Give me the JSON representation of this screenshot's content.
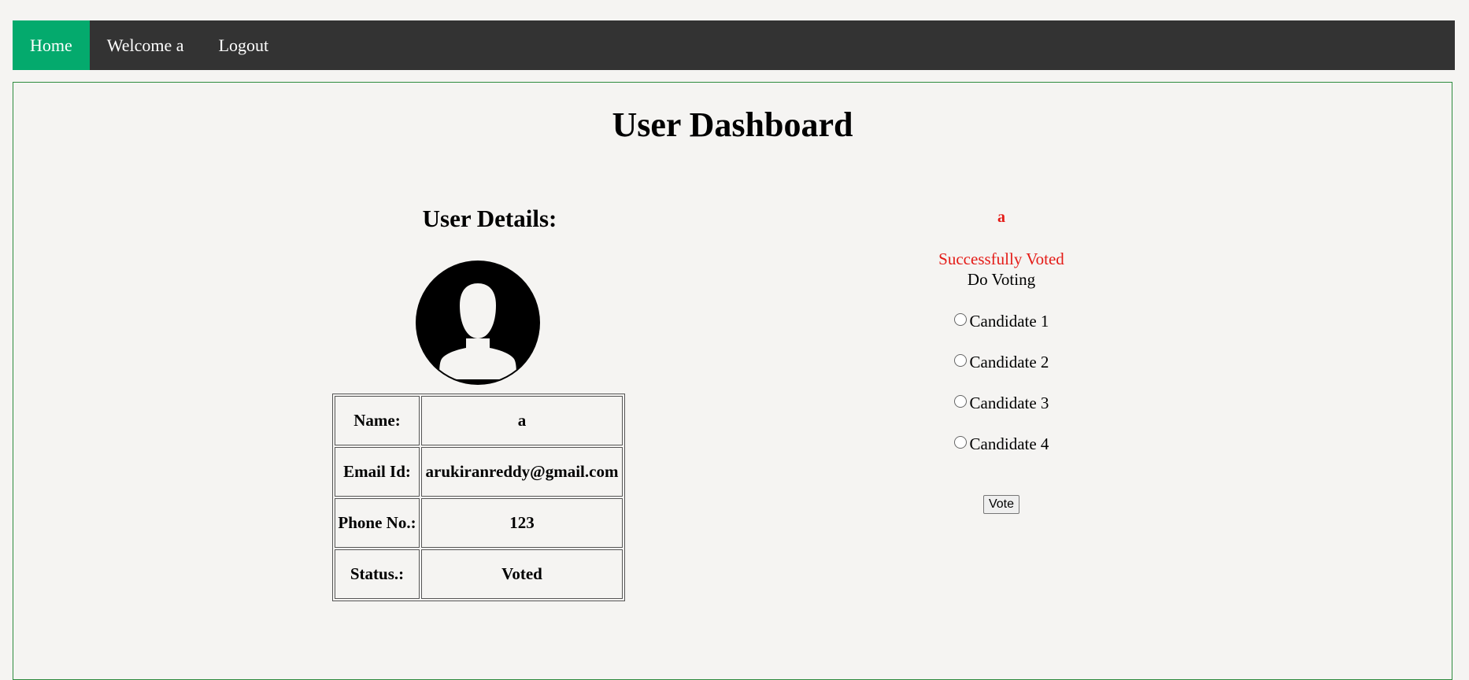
{
  "nav": {
    "items": [
      {
        "label": "Home",
        "active": true
      },
      {
        "label": "Welcome a",
        "active": false
      },
      {
        "label": "Logout",
        "active": false
      }
    ]
  },
  "page": {
    "title": "User Dashboard"
  },
  "user_details": {
    "heading": "User Details:",
    "avatar_icon": "user-silhouette-icon",
    "rows": [
      {
        "label": "Name:",
        "value": "a"
      },
      {
        "label": "Email Id:",
        "value": "arukiranreddy@gmail.com"
      },
      {
        "label": "Phone No.:",
        "value": "123"
      },
      {
        "label": "Status.:",
        "value": "Voted"
      }
    ]
  },
  "voting": {
    "voter_name": "a",
    "status_message": "Successfully Voted",
    "title": "Do Voting",
    "options": [
      {
        "label": "Candidate 1",
        "selected": false
      },
      {
        "label": "Candidate 2",
        "selected": false
      },
      {
        "label": "Candidate 3",
        "selected": false
      },
      {
        "label": "Candidate 4",
        "selected": false
      }
    ],
    "button_label": "Vote"
  },
  "colors": {
    "nav_bg": "#333333",
    "nav_active": "#04aa6d",
    "accent_red": "#e41b17",
    "panel_border": "#2e8b3e",
    "page_bg": "#f5f4f2"
  }
}
